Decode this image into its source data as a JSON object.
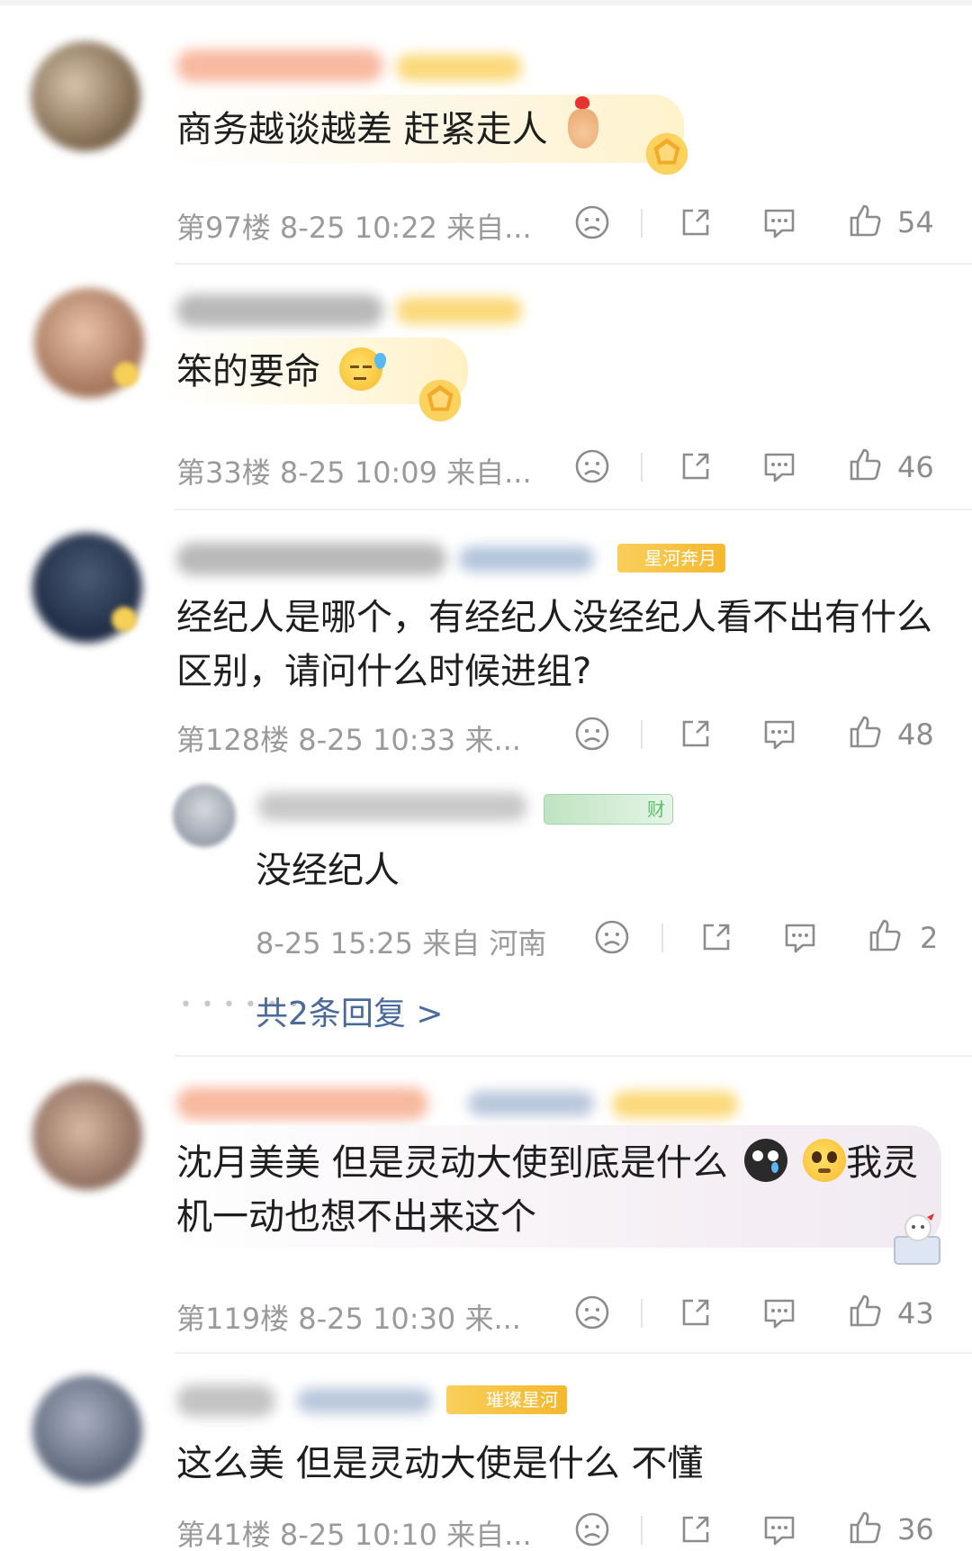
{
  "comments": [
    {
      "text": "商务越谈越差 赶紧走人",
      "floor": "第97楼",
      "time": "8-25 10:22",
      "location": "来自...",
      "likes": "54",
      "emoji_icons": [
        "finger-heart-icon"
      ]
    },
    {
      "text": "笨的要命",
      "floor": "第33楼",
      "time": "8-25 10:09",
      "location": "来自...",
      "likes": "46",
      "emoji_icons": [
        "sweat-face-icon"
      ]
    },
    {
      "text": "经纪人是哪个，有经纪人没经纪人看不出有什么区别，请问什么时候进组?",
      "floor": "第128楼",
      "time": "8-25 10:33",
      "location": "来...",
      "likes": "48",
      "tag": "星河奔月",
      "reply": {
        "text": "没经纪人",
        "tag": "财",
        "time": "8-25 15:25",
        "location": "来自 河南",
        "likes": "2"
      },
      "more_replies": "共2条回复 >"
    },
    {
      "text_a": "沈月美美 但是灵动大使到底是什么",
      "text_b": "我灵机一动也想不出来这个",
      "floor": "第119楼",
      "time": "8-25 10:30",
      "location": "来...",
      "likes": "43",
      "emoji_icons": [
        "crying-black-face-icon",
        "pleading-face-icon"
      ]
    },
    {
      "text": "这么美 但是灵动大使是什么 不懂",
      "floor": "第41楼",
      "time": "8-25 10:10",
      "location": "来自...",
      "likes": "36",
      "tag": "璀璨星河"
    }
  ],
  "colors": {
    "meta_text": "#9a9a9a",
    "link": "#4a6a9c",
    "tag_orange": "#f5b82e",
    "tag_green": "#5cbf6b"
  }
}
